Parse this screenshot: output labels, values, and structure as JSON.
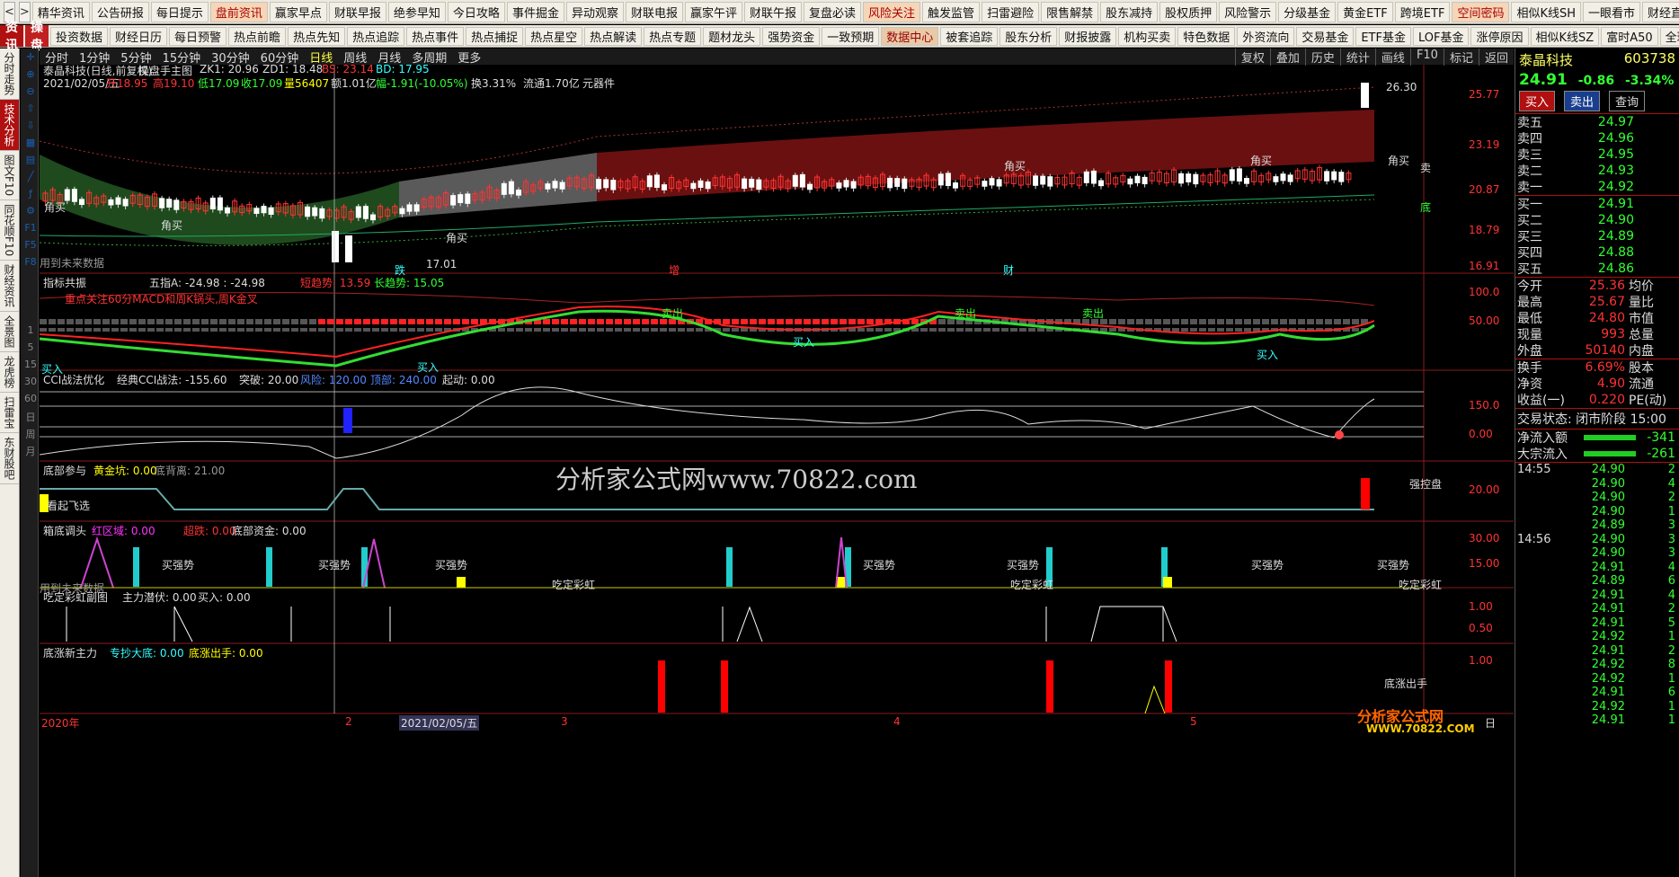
{
  "top_nav": {
    "back": "<",
    "fwd": ">",
    "items": [
      "精华资讯",
      "公告研报",
      "每日提示",
      "盘前资讯",
      "赢家早点",
      "财联早报",
      "绝参早知",
      "今日攻略",
      "事件掘金",
      "异动观察",
      "财联电报",
      "赢家午评",
      "财联午报",
      "复盘必读",
      "风险关注",
      "触发监管",
      "扫雷避险",
      "限售解禁",
      "股东减持",
      "股权质押",
      "风险警示",
      "分级基金",
      "黄金ETF",
      "跨境ETF",
      "空间密码",
      "相似K线SH",
      "一眼看市",
      "财经直播"
    ],
    "hot": [
      3,
      14,
      24
    ]
  },
  "sub_nav": {
    "tabs": [
      "资讯",
      "操盘"
    ],
    "items": [
      "投资数据",
      "财经日历",
      "每日预警",
      "热点前瞻",
      "热点先知",
      "热点追踪",
      "热点事件",
      "热点捕捉",
      "热点星空",
      "热点解读",
      "热点专题",
      "题材龙头",
      "强势资金",
      "一致预期",
      "数据中心",
      "被套追踪",
      "股东分析",
      "财报披露",
      "机构买卖",
      "特色数据",
      "外资流向",
      "交易基金",
      "ETF基金",
      "LOF基金",
      "涨停原因",
      "相似K线SZ",
      "富时A50",
      "全球行情"
    ],
    "hot": [
      14
    ]
  },
  "side_tabs": [
    "分时走势",
    "技术分析",
    "图文F10",
    "同花顺F10",
    "财经资讯",
    "全景图",
    "龙虎榜",
    "扫雷宝",
    "东财股吧"
  ],
  "period_bar": {
    "items": [
      "分时",
      "1分钟",
      "5分钟",
      "15分钟",
      "30分钟",
      "60分钟",
      "日线",
      "周线",
      "月线",
      "多周期",
      "更多"
    ],
    "active": "日线",
    "tools": [
      "复权",
      "叠加",
      "历史",
      "统计",
      "画线",
      "F10",
      "标记",
      "返回"
    ]
  },
  "main": {
    "title": "泰晶科技(日线,前复权)",
    "formula": "操盘手主图",
    "zk": "ZK1: 20.96",
    "zd": "ZD1: 18.48",
    "bs": "BS: 23.14",
    "bd": "BD: 17.95",
    "ohlc": {
      "date": "2021/02/05/五",
      "open": "开18.95",
      "high": "高19.10",
      "low": "低17.09",
      "close": "收17.09",
      "vol": "量56407",
      "amt": "额1.01亿",
      "chg": "幅-1.91(-10.05%)",
      "turnover": "换3.31%",
      "float": "流通1.70亿",
      "ind": "元器件"
    },
    "price_axis": [
      "25.77",
      "23.19",
      "20.87",
      "18.79",
      "16.91"
    ],
    "high_label": "26.30",
    "low_label": "17.01",
    "future_note": "用到未来数据",
    "signals": [
      "角买",
      "角买",
      "角买",
      "角买",
      "角买",
      "角买"
    ],
    "mark_left": "跌",
    "mark_mid": "增",
    "mark_right": "财",
    "sell_mark": "卖",
    "bottom_mark": "底"
  },
  "panel1": {
    "name": "指标共振",
    "a": "五指A: -24.98 : -24.98",
    "b": "短趋势: 13.59",
    "c": "长趋势: 15.05",
    "note": "重点关注60分MACD和周K锅头,周K金叉",
    "axis": [
      "100.0",
      "50.00"
    ],
    "buy": "买入",
    "sell": "卖出"
  },
  "panel2": {
    "name": "CCI战法优化",
    "a": "经典CCI战法: -155.60",
    "b": "突破: 20.00",
    "c": "风险: 120.00",
    "d": "顶部: 240.00",
    "e": "起动: 0.00",
    "axis": [
      "150.0",
      "0.00"
    ]
  },
  "panel3": {
    "name": "底部参与",
    "a": "黄金坑: 0.00",
    "b": "底背离: 21.00",
    "axis": [
      "20.00"
    ],
    "left_label": "看起飞选",
    "right_label": "强控盘"
  },
  "panel4": {
    "name": "箱底调头",
    "a": "红区域: 0.00",
    "b": "超跌: 0.00",
    "c": "底部资金: 0.00",
    "axis": [
      "30.00",
      "15.00"
    ],
    "lbl": "买强势",
    "rainbow": "吃定彩虹",
    "future": "用到未来数据"
  },
  "panel5": {
    "name": "吃定彩虹副图",
    "a": "主力潜伏: 0.00",
    "b": "买入: 0.00",
    "axis": [
      "1.00",
      "0.50"
    ]
  },
  "panel6": {
    "name": "底涨新主力",
    "a": "专抄大底: 0.00",
    "b": "底涨出手: 0.00",
    "axis": [
      "1.00"
    ],
    "lbl": "底涨出手"
  },
  "time_axis": {
    "labels": [
      "2020年",
      "2",
      "2021/02/05/五",
      "3",
      "4",
      "5"
    ],
    "end": "日"
  },
  "watermark": {
    "main": "分析家公式网www.70822.com",
    "sub": "www.70822.com",
    "corner": "分析家公式网",
    "corner_url": "WWW.70822.COM"
  },
  "quote": {
    "name": "泰晶科技",
    "code": "603738",
    "price": "24.91",
    "chg": "-0.86",
    "pct": "-3.34%",
    "buttons": [
      "买入",
      "卖出",
      "查询"
    ],
    "asks": [
      {
        "l": "卖五",
        "p": "24.97"
      },
      {
        "l": "卖四",
        "p": "24.96"
      },
      {
        "l": "卖三",
        "p": "24.95"
      },
      {
        "l": "卖二",
        "p": "24.93"
      },
      {
        "l": "卖一",
        "p": "24.92"
      }
    ],
    "bids": [
      {
        "l": "买一",
        "p": "24.91"
      },
      {
        "l": "买二",
        "p": "24.90"
      },
      {
        "l": "买三",
        "p": "24.89"
      },
      {
        "l": "买四",
        "p": "24.88"
      },
      {
        "l": "买五",
        "p": "24.86"
      }
    ],
    "stats": [
      {
        "l": "今开",
        "v": "25.36",
        "r": "均价"
      },
      {
        "l": "最高",
        "v": "25.67",
        "r": "量比"
      },
      {
        "l": "最低",
        "v": "24.80",
        "r": "市值"
      },
      {
        "l": "现量",
        "v": "993",
        "r": "总量"
      },
      {
        "l": "外盘",
        "v": "50140",
        "r": "内盘"
      }
    ],
    "stats2": [
      {
        "l": "换手",
        "v": "6.69%",
        "r": "股本"
      },
      {
        "l": "净资",
        "v": "4.90",
        "r": "流通"
      },
      {
        "l": "收益(一)",
        "v": "0.220",
        "r": "PE(动)"
      }
    ],
    "status": "交易状态: 闭市阶段 15:00",
    "flows": [
      {
        "l": "净流入额",
        "v": "-341"
      },
      {
        "l": "大宗流入",
        "v": "-261"
      }
    ],
    "ticks_a": {
      "time": "14:55",
      "prices": [
        "24.90",
        "24.90",
        "24.90",
        "24.90",
        "24.89"
      ],
      "vols": [
        "2",
        "4",
        "2",
        "1",
        "3"
      ]
    },
    "ticks_b": {
      "time": "14:56",
      "prices": [
        "24.90",
        "24.90",
        "24.91",
        "24.89",
        "24.91",
        "24.91",
        "24.91",
        "24.92",
        "24.91",
        "24.92",
        "24.92",
        "24.91",
        "24.92",
        "24.91"
      ],
      "vols": [
        "3",
        "3",
        "4",
        "6",
        "4",
        "2",
        "5",
        "1",
        "2",
        "8",
        "1",
        "6",
        "1",
        "1"
      ]
    }
  },
  "colors": {
    "up": "#ff3333",
    "down": "#33ff33",
    "text": "#dddddd",
    "yellow": "#ffff00",
    "accent": "#b01010"
  }
}
